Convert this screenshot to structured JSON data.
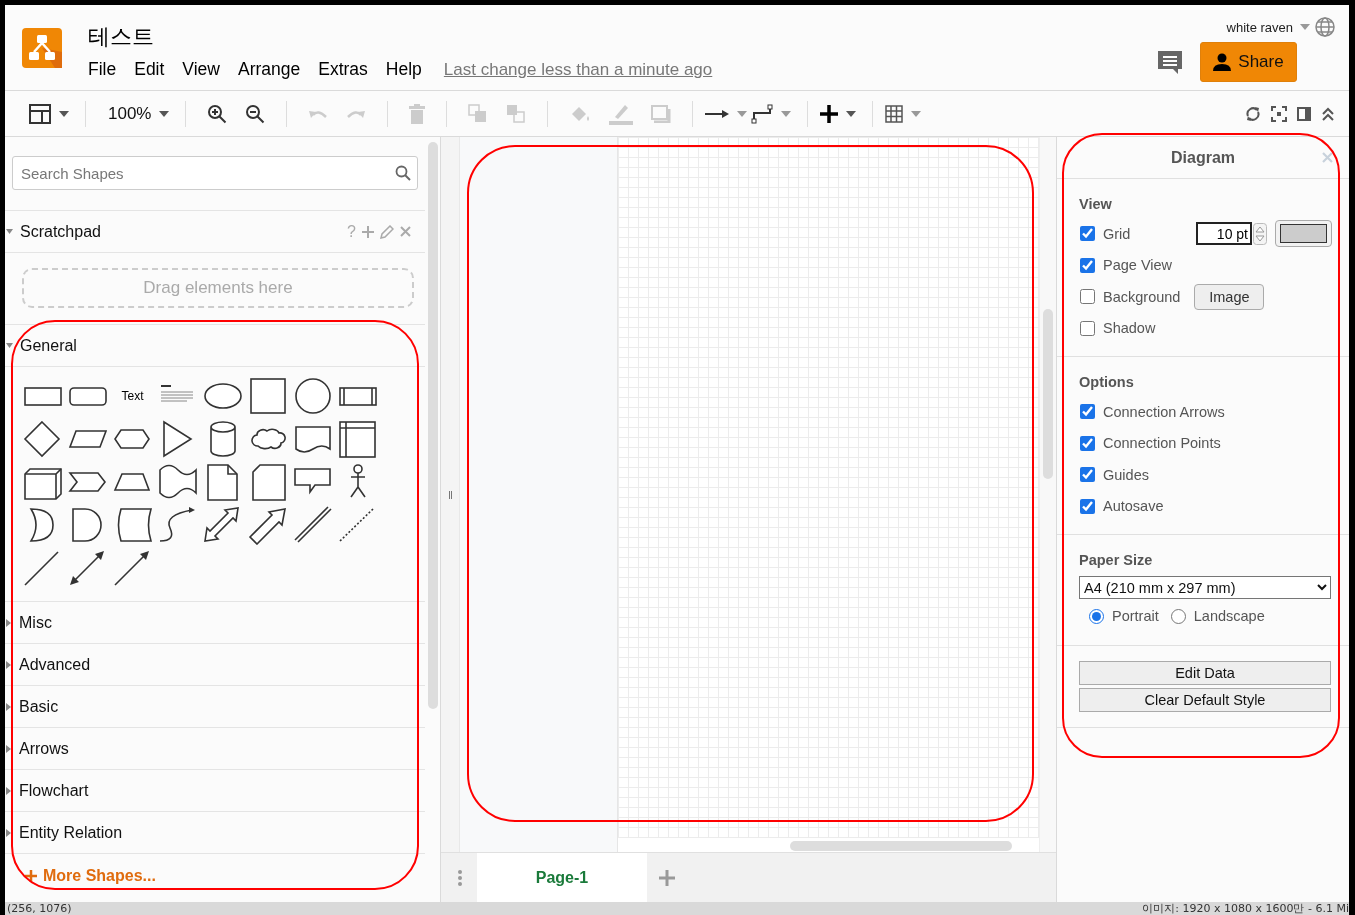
{
  "app": {
    "title": "테스트",
    "menu": [
      "File",
      "Edit",
      "View",
      "Arrange",
      "Extras",
      "Help"
    ],
    "last_change": "Last change less than a minute ago",
    "user": "white raven",
    "share_label": "Share"
  },
  "toolbar": {
    "zoom": "100%"
  },
  "sidebar": {
    "search": {
      "placeholder": "Search Shapes"
    },
    "scratchpad": {
      "label": "Scratchpad",
      "help": "?",
      "drop_hint": "Drag elements here"
    },
    "highlighted": true,
    "general": {
      "label": "General",
      "expanded": true,
      "shapes": [
        {
          "kind": "rect"
        },
        {
          "kind": "rounded"
        },
        {
          "kind": "text",
          "label": "Text"
        },
        {
          "kind": "heading"
        },
        {
          "kind": "ellipse"
        },
        {
          "kind": "square"
        },
        {
          "kind": "circle"
        },
        {
          "kind": "process"
        },
        {
          "kind": "diamond"
        },
        {
          "kind": "parallelogram"
        },
        {
          "kind": "hexagon"
        },
        {
          "kind": "triangle"
        },
        {
          "kind": "cylinder"
        },
        {
          "kind": "cloud"
        },
        {
          "kind": "document"
        },
        {
          "kind": "storage"
        },
        {
          "kind": "cube"
        },
        {
          "kind": "step"
        },
        {
          "kind": "trapezoid"
        },
        {
          "kind": "tape"
        },
        {
          "kind": "note"
        },
        {
          "kind": "card"
        },
        {
          "kind": "callout"
        },
        {
          "kind": "actor"
        },
        {
          "kind": "crescent"
        },
        {
          "kind": "delay"
        },
        {
          "kind": "datastore"
        },
        {
          "kind": "curve"
        },
        {
          "kind": "bidirarrow"
        },
        {
          "kind": "arrow"
        },
        {
          "kind": "link"
        },
        {
          "kind": "dashed"
        },
        {
          "kind": "line"
        },
        {
          "kind": "biconnector"
        },
        {
          "kind": "connector"
        }
      ]
    },
    "sections": [
      {
        "label": "Misc",
        "expanded": false
      },
      {
        "label": "Advanced",
        "expanded": false
      },
      {
        "label": "Basic",
        "expanded": false
      },
      {
        "label": "Arrows",
        "expanded": false
      },
      {
        "label": "Flowchart",
        "expanded": false
      },
      {
        "label": "Entity Relation",
        "expanded": false
      }
    ],
    "more_shapes": "More Shapes..."
  },
  "canvas": {
    "highlighted": true
  },
  "pages": {
    "tabs": [
      {
        "label": "Page-1",
        "selected": true
      }
    ]
  },
  "format_panel": {
    "title": "Diagram",
    "highlighted": true,
    "view": {
      "heading": "View",
      "options": [
        {
          "label": "Grid",
          "checked": true,
          "kind": "grid",
          "size": "10 pt",
          "color": "#cccccc"
        },
        {
          "label": "Page View",
          "checked": true,
          "kind": "plain"
        },
        {
          "label": "Background",
          "checked": false,
          "kind": "button",
          "button": "Image"
        },
        {
          "label": "Shadow",
          "checked": false,
          "kind": "plain"
        }
      ]
    },
    "options": {
      "heading": "Options",
      "items": [
        {
          "label": "Connection Arrows",
          "checked": true
        },
        {
          "label": "Connection Points",
          "checked": true
        },
        {
          "label": "Guides",
          "checked": true
        },
        {
          "label": "Autosave",
          "checked": true
        }
      ]
    },
    "paper": {
      "heading": "Paper Size",
      "size": "A4 (210 mm x 297 mm)",
      "orientations": [
        {
          "label": "Portrait",
          "selected": true
        },
        {
          "label": "Landscape",
          "selected": false
        }
      ]
    },
    "buttons": [
      "Edit Data",
      "Clear Default Style"
    ]
  },
  "status_bar": {
    "left": "(256, 1076)",
    "right": "이미지: 1920 x 1080 x 1600만 - 6.1 Mi"
  }
}
